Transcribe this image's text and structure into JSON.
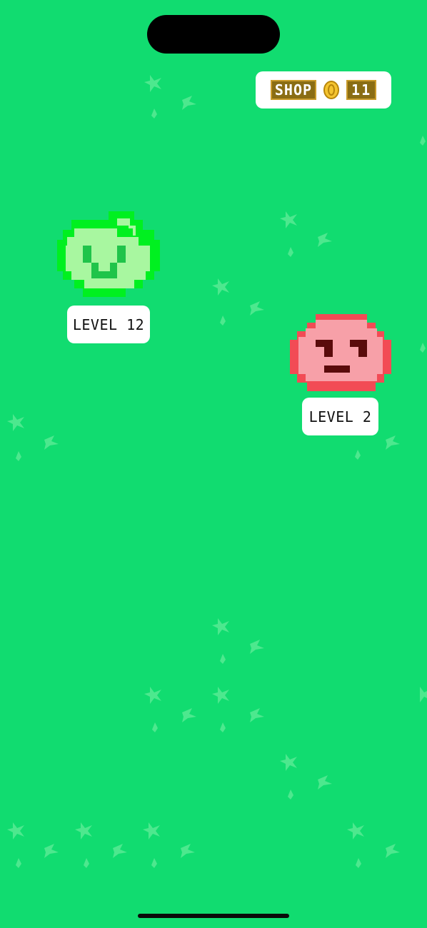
{
  "hud": {
    "shop_label": "SHOP",
    "coin_count": "11",
    "coin_icon": "gold-coin"
  },
  "monsters": [
    {
      "name": "green-slime",
      "level_label": "LEVEL 12",
      "color": "#a8f7a0"
    },
    {
      "name": "red-slime",
      "level_label": "LEVEL 2",
      "color": "#f7a0a8"
    }
  ],
  "colors": {
    "background": "#11dc70",
    "grass_tuft": "#4de88e",
    "shop_tag": "#8a6d14",
    "coin": "#f4c430"
  }
}
